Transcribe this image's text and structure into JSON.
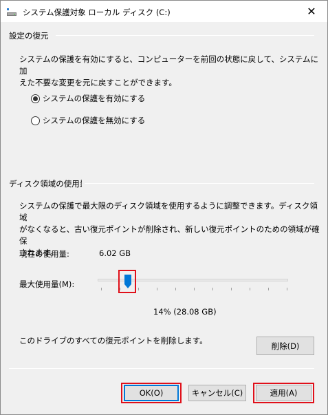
{
  "window": {
    "title": "システム保護対象 ローカル ディスク (C:)",
    "close_glyph": "✕"
  },
  "restore_group": {
    "label": "設定の復元",
    "description_line1": "システムの保護を有効にすると、コンピューターを前回の状態に戻して、システムに加",
    "description_line2": "えた不要な変更を元に戻すことができます。",
    "options": [
      {
        "label": "システムの保護を有効にする",
        "selected": true
      },
      {
        "label": "システムの保護を無効にする",
        "selected": false
      }
    ]
  },
  "disk_group": {
    "label": "ディスク領域の使用量",
    "description_line1": "システムの保護で最大限のディスク領域を使用するように調整できます。ディスク領域",
    "description_line2": "がなくなると、古い復元ポイントが削除され、新しい復元ポイントのための領域が確保",
    "description_line3": "されます。",
    "current_usage_label": "現在の使用量:",
    "current_usage_value": "6.02 GB",
    "max_usage_label": "最大使用量(M):",
    "slider_percent": 14,
    "slider_value_text": "14% (28.08 GB)",
    "delete_text": "このドライブのすべての復元ポイントを削除します。",
    "delete_button": "削除(D)"
  },
  "footer": {
    "ok": "OK(O)",
    "cancel": "キャンセル(C)",
    "apply": "適用(A)"
  },
  "colors": {
    "highlight": "#e0101a",
    "accent": "#0078d7"
  }
}
